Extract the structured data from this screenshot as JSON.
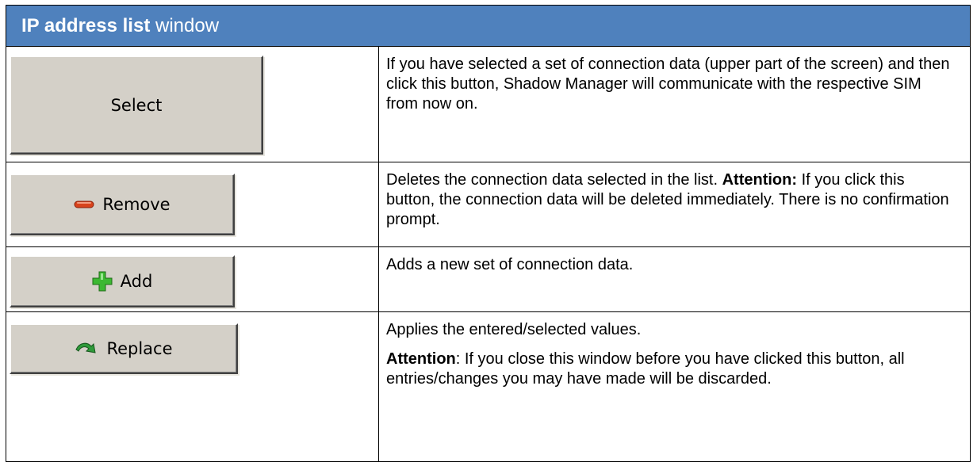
{
  "header": {
    "title_bold": "IP address list",
    "title_rest": " window"
  },
  "rows": [
    {
      "button_label": "Select",
      "icon": "none",
      "description": [
        "If you have selected a set of connection data (upper part of the screen) and then click this button, Shadow Manager will communicate with the respective SIM from now on."
      ]
    },
    {
      "button_label": "Remove",
      "icon": "minus-icon",
      "description_intro": "Deletes the connection data selected in the list. ",
      "description_bold": "Attention:",
      "description_rest": " If you click this button, the connection data will be deleted immediately. There is no confirmation prompt."
    },
    {
      "button_label": "Add",
      "icon": "plus-icon",
      "description": [
        "Adds a new set of connection data."
      ]
    },
    {
      "button_label": "Replace",
      "icon": "replace-arrow-icon",
      "description_p1": "Applies the entered/selected values.",
      "description_p2_bold": "Attention",
      "description_p2_rest": ": If you close this window before you have clicked this button, all entries/changes you may have made will be discarded."
    }
  ],
  "colors": {
    "header_bg": "#4f81bd",
    "button_face": "#d4d0c8",
    "minus_icon": "#d8431c",
    "plus_icon": "#3cb832",
    "arrow_icon": "#2f9a3a"
  }
}
